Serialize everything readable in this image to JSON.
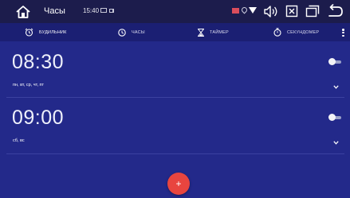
{
  "statusbar": {
    "app_title": "Часы",
    "time": "15:40",
    "icons": [
      "home-icon",
      "message-icon",
      "cast-icon",
      "signal-icon",
      "location-icon",
      "wifi-icon",
      "volume-icon",
      "close-window-icon",
      "recent-apps-icon",
      "back-icon"
    ]
  },
  "tabs": [
    {
      "label": "БУДИЛЬНИК",
      "icon": "alarm-clock-icon",
      "active": true
    },
    {
      "label": "ЧАСЫ",
      "icon": "clock-icon",
      "active": false
    },
    {
      "label": "ТАЙМЕР",
      "icon": "hourglass-icon",
      "active": false
    },
    {
      "label": "СЕКУНДОМЕР",
      "icon": "stopwatch-icon",
      "active": false
    }
  ],
  "alarms": [
    {
      "time": "08:30",
      "days": "пн, вт, ср, чт, пт",
      "enabled": false
    },
    {
      "time": "09:00",
      "days": "сб, вс",
      "enabled": false
    }
  ],
  "fab": {
    "label": "+"
  },
  "colors": {
    "statusbar_bg": "#1c1c4c",
    "tabbar_bg": "#1b1f73",
    "main_bg": "#23298a",
    "fab": "#e8453f"
  }
}
